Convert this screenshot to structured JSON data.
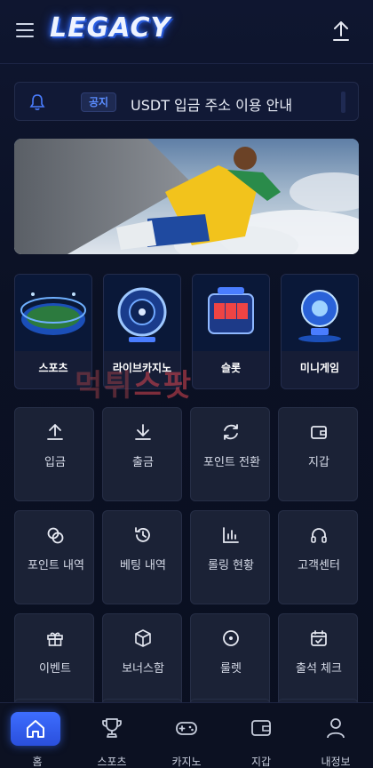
{
  "header": {
    "logo": "LEGACY"
  },
  "notice": {
    "badge": "공지",
    "text": "USDT 입금 주소 이용 안내"
  },
  "games": [
    {
      "label": "스포츠",
      "icon": "stadium-icon"
    },
    {
      "label": "라이브카지노",
      "icon": "roulette-icon"
    },
    {
      "label": "슬롯",
      "icon": "slot-machine-icon"
    },
    {
      "label": "미니게임",
      "icon": "trophy-orb-icon"
    }
  ],
  "watermark": {
    "part1": "먹튀",
    "part2": "스팟"
  },
  "menu": [
    {
      "label": "입금",
      "icon": "upload-icon"
    },
    {
      "label": "출금",
      "icon": "download-icon"
    },
    {
      "label": "포인트 전환",
      "icon": "refresh-icon"
    },
    {
      "label": "지갑",
      "icon": "wallet-icon"
    },
    {
      "label": "포인트 내역",
      "icon": "coins-icon"
    },
    {
      "label": "베팅 내역",
      "icon": "history-icon"
    },
    {
      "label": "롤링 현황",
      "icon": "bar-chart-icon"
    },
    {
      "label": "고객센터",
      "icon": "headset-icon"
    },
    {
      "label": "이벤트",
      "icon": "gift-icon"
    },
    {
      "label": "보너스함",
      "icon": "box-icon"
    },
    {
      "label": "룰렛",
      "icon": "target-icon"
    },
    {
      "label": "출석 체크",
      "icon": "calendar-check-icon"
    }
  ],
  "nav": [
    {
      "label": "홈",
      "icon": "home-icon"
    },
    {
      "label": "스포츠",
      "icon": "trophy-icon"
    },
    {
      "label": "카지노",
      "icon": "gamepad-icon"
    },
    {
      "label": "지갑",
      "icon": "wallet-icon"
    },
    {
      "label": "내정보",
      "icon": "user-icon"
    }
  ],
  "colors": {
    "background": "#0d1224",
    "tile": "#1b2236",
    "accent": "#3d6dff",
    "badge_text": "#5a8cff"
  }
}
